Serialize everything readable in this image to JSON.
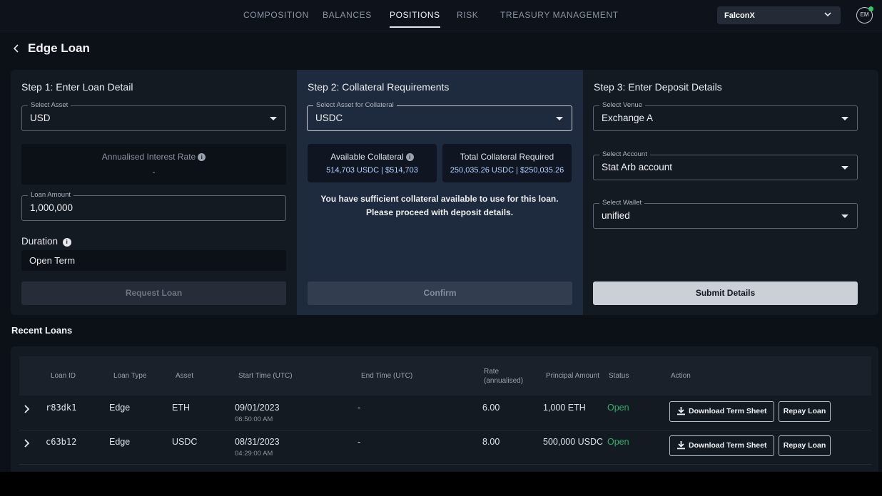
{
  "nav": {
    "tabs": [
      "COMPOSITION",
      "BALANCES",
      "POSITIONS",
      "RISK",
      "TREASURY MANAGEMENT"
    ],
    "active_tab": "POSITIONS",
    "org_select": "FalconX",
    "avatar_initials": "EM"
  },
  "page": {
    "title": "Edge Loan"
  },
  "step1": {
    "title": "Step 1: Enter Loan Detail",
    "asset_label": "Select Asset",
    "asset_value": "USD",
    "rate_label": "Annualised Interest Rate",
    "rate_value": "-",
    "amount_label": "Loan Amount",
    "amount_value": "1,000,000",
    "duration_label": "Duration",
    "duration_value": "Open Term",
    "request_button": "Request Loan"
  },
  "step2": {
    "title": "Step 2: Collateral Requirements",
    "asset_label": "Select Asset for Collateral",
    "asset_value": "USDC",
    "available_label": "Available Collateral",
    "available_value": "514,703 USDC | $514,703",
    "required_label": "Total Collateral Required",
    "required_value": "250,035.26 USDC | $250,035.26",
    "message": "You have sufficient collateral available to use for this loan. Please proceed with deposit details.",
    "confirm_button": "Confirm"
  },
  "step3": {
    "title": "Step 3: Enter Deposit Details",
    "venue_label": "Select Venue",
    "venue_value": "Exchange A",
    "account_label": "Select Account",
    "account_value": "Stat Arb account",
    "wallet_label": "Select Wallet",
    "wallet_value": "unified",
    "submit_button": "Submit Details"
  },
  "recent_loans": {
    "title": "Recent Loans",
    "columns": {
      "loan_id": "Loan ID",
      "loan_type": "Loan Type",
      "asset": "Asset",
      "start": "Start Time (UTC)",
      "end": "End Time (UTC)",
      "rate": "Rate (annualised)",
      "principal": "Principal Amount",
      "status": "Status",
      "action": "Action"
    },
    "rows": [
      {
        "id": "r83dk1",
        "type": "Edge",
        "asset": "ETH",
        "start_date": "09/01/2023",
        "start_time": "06:50:00 AM",
        "end": "-",
        "rate": "6.00",
        "principal": "1,000 ETH",
        "status": "Open"
      },
      {
        "id": "c63b12",
        "type": "Edge",
        "asset": "USDC",
        "start_date": "08/31/2023",
        "start_time": "04:29:00 AM",
        "end": "-",
        "rate": "8.00",
        "principal": "500,000 USDC",
        "status": "Open"
      }
    ],
    "download_label": "Download Term Sheet",
    "repay_label": "Repay Loan"
  },
  "colors": {
    "accent_status_open": "#2fae67",
    "step2_background": "#1e2a3d",
    "avatar_online": "#37c76b"
  }
}
